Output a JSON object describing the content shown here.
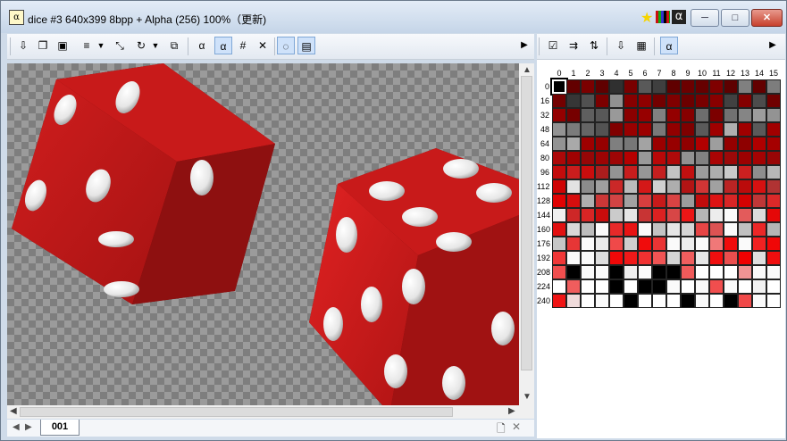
{
  "window": {
    "title": "dice #3  640x399  8bpp + Alpha (256)  100%（更新)",
    "minimize_label": "─",
    "maximize_label": "□",
    "close_label": "✕"
  },
  "image_icons": [
    "green-star-icon",
    "palette-grid-icon",
    "alpha-icon"
  ],
  "bottom": {
    "tab_label": "001"
  },
  "palette": {
    "column_headers": [
      "0",
      "1",
      "2",
      "3",
      "4",
      "5",
      "6",
      "7",
      "8",
      "9",
      "10",
      "11",
      "12",
      "13",
      "14",
      "15"
    ],
    "row_headers": [
      "0",
      "16",
      "32",
      "48",
      "64",
      "80",
      "96",
      "112",
      "128",
      "144",
      "160",
      "176",
      "192",
      "208",
      "224",
      "240"
    ],
    "selected_index": 0
  },
  "colors": {
    "title_gradient_top": "#e3ecf7",
    "close_red": "#c7412d",
    "die_red": "#c01a1a",
    "die_dark": "#6a0a0a"
  }
}
